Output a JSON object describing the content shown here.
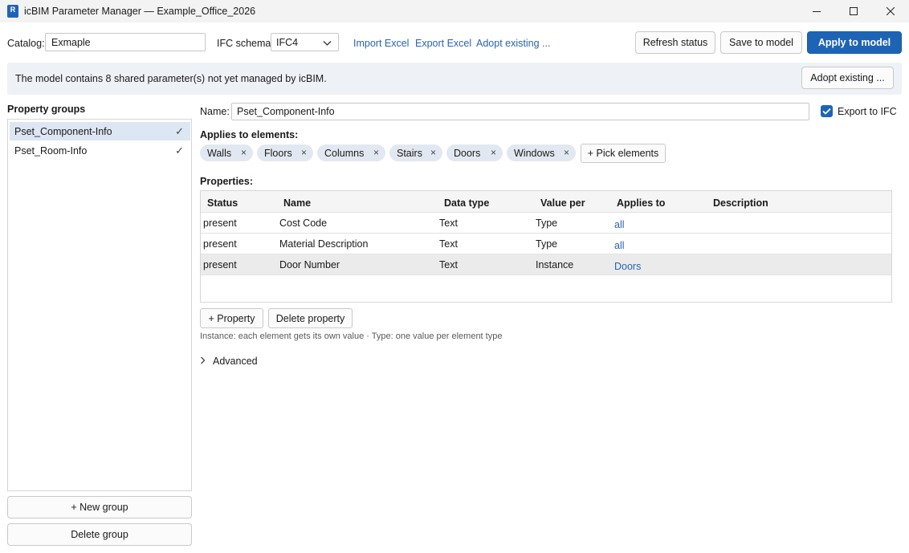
{
  "window": {
    "app_icon_letter": "R",
    "title": "icBIM Parameter Manager — Example_Office_2026"
  },
  "toolbar": {
    "catalog_label": "Catalog:",
    "catalog_value": "Exmaple",
    "ifc_schema_label": "IFC schema:",
    "ifc_schema_value": "IFC4",
    "links": [
      "Import Excel",
      "Export Excel",
      "Adopt existing ..."
    ],
    "refresh_label": "Refresh status",
    "save_label": "Save to model",
    "apply_label": "Apply to model"
  },
  "banner": {
    "text": "The model contains 8 shared parameter(s) not yet managed by icBIM.",
    "button_label": "Adopt existing ..."
  },
  "property_groups": {
    "title": "Property groups",
    "items": [
      {
        "label": "Pset_Component-Info",
        "check": "✓",
        "selected": true
      },
      {
        "label": "Pset_Room-Info",
        "check": "✓",
        "selected": false
      }
    ],
    "new_group_label": "+ New group",
    "delete_group_label": "Delete group"
  },
  "editor": {
    "name_label": "Name:",
    "name_value": "Pset_Component-Info",
    "export_ifc_label": "Export to IFC",
    "export_ifc_checked": true,
    "applies_label": "Applies to elements:",
    "elements": [
      "Walls",
      "Floors",
      "Columns",
      "Stairs",
      "Doors",
      "Windows"
    ],
    "chip_remove_glyph": "×",
    "pick_elements_label": "+ Pick elements",
    "properties_label": "Properties:",
    "columns": [
      "Status",
      "Name",
      "Data type",
      "Value per",
      "Applies to",
      "Description"
    ],
    "rows": [
      {
        "status": "present",
        "name": "Cost Code",
        "data_type": "Text",
        "value_per": "Type",
        "applies_to": "all",
        "description": ""
      },
      {
        "status": "present",
        "name": "Material Description",
        "data_type": "Text",
        "value_per": "Type",
        "applies_to": "all",
        "description": ""
      },
      {
        "status": "present",
        "name": "Door Number",
        "data_type": "Text",
        "value_per": "Instance",
        "applies_to": "Doors",
        "description": ""
      }
    ],
    "add_property_label": "+ Property",
    "delete_property_label": "Delete property",
    "hint": "Instance: each element gets its own value · Type: one value per element type",
    "advanced_label": "Advanced"
  },
  "colors": {
    "accent": "#1e64b5",
    "link": "#2a63b0",
    "selection": "#dde6f3"
  }
}
